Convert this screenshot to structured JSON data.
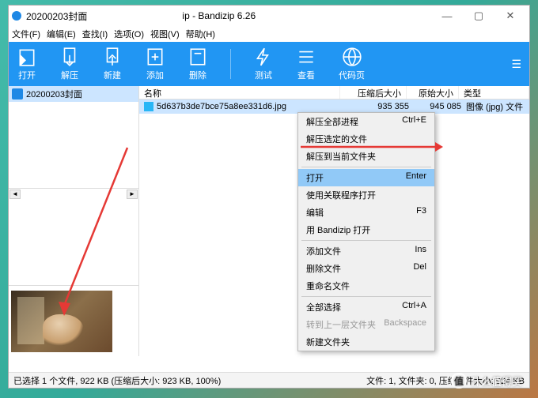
{
  "title": {
    "folder": "20200203封面",
    "app": "ip - Bandizip 6.26"
  },
  "menu": [
    "文件(F)",
    "编辑(E)",
    "查找(I)",
    "选项(O)",
    "视图(V)",
    "帮助(H)"
  ],
  "toolbar": {
    "open": "打开",
    "extract": "解压",
    "new": "新建",
    "add": "添加",
    "delete": "删除",
    "test": "测试",
    "view": "查看",
    "codepage": "代码页"
  },
  "sidebar": {
    "label": "20200203封面"
  },
  "columns": {
    "name": "名称",
    "csize": "压缩后大小",
    "osize": "原始大小",
    "type": "类型"
  },
  "filerow": {
    "name": "5d637b3de7bce75a8ee331d6.jpg",
    "csize": "935 355",
    "osize": "945 085",
    "type": "图像 (jpg) 文件"
  },
  "ctx": {
    "extract_all": "解压全部进程",
    "extract_all_key": "Ctrl+E",
    "extract_sel": "解压选定的文件",
    "extract_cur": "解压到当前文件夹",
    "open": "打开",
    "open_key": "Enter",
    "open_assoc": "使用关联程序打开",
    "edit": "编辑",
    "edit_key": "F3",
    "open_bz": "用 Bandizip 打开",
    "add": "添加文件",
    "add_key": "Ins",
    "del": "删除文件",
    "del_key": "Del",
    "rename": "重命名文件",
    "selall": "全部选择",
    "selall_key": "Ctrl+A",
    "back": "转到上一层文件夹",
    "back_key": "Backspace",
    "newfolder": "新建文件夹"
  },
  "status": {
    "left": "已选择 1 个文件, 922 KB (压缩后大小: 923 KB, 100%)",
    "right": "文件: 1, 文件夹: 0, 压缩文件大小: 924 KB"
  },
  "watermark": "什么值得买"
}
